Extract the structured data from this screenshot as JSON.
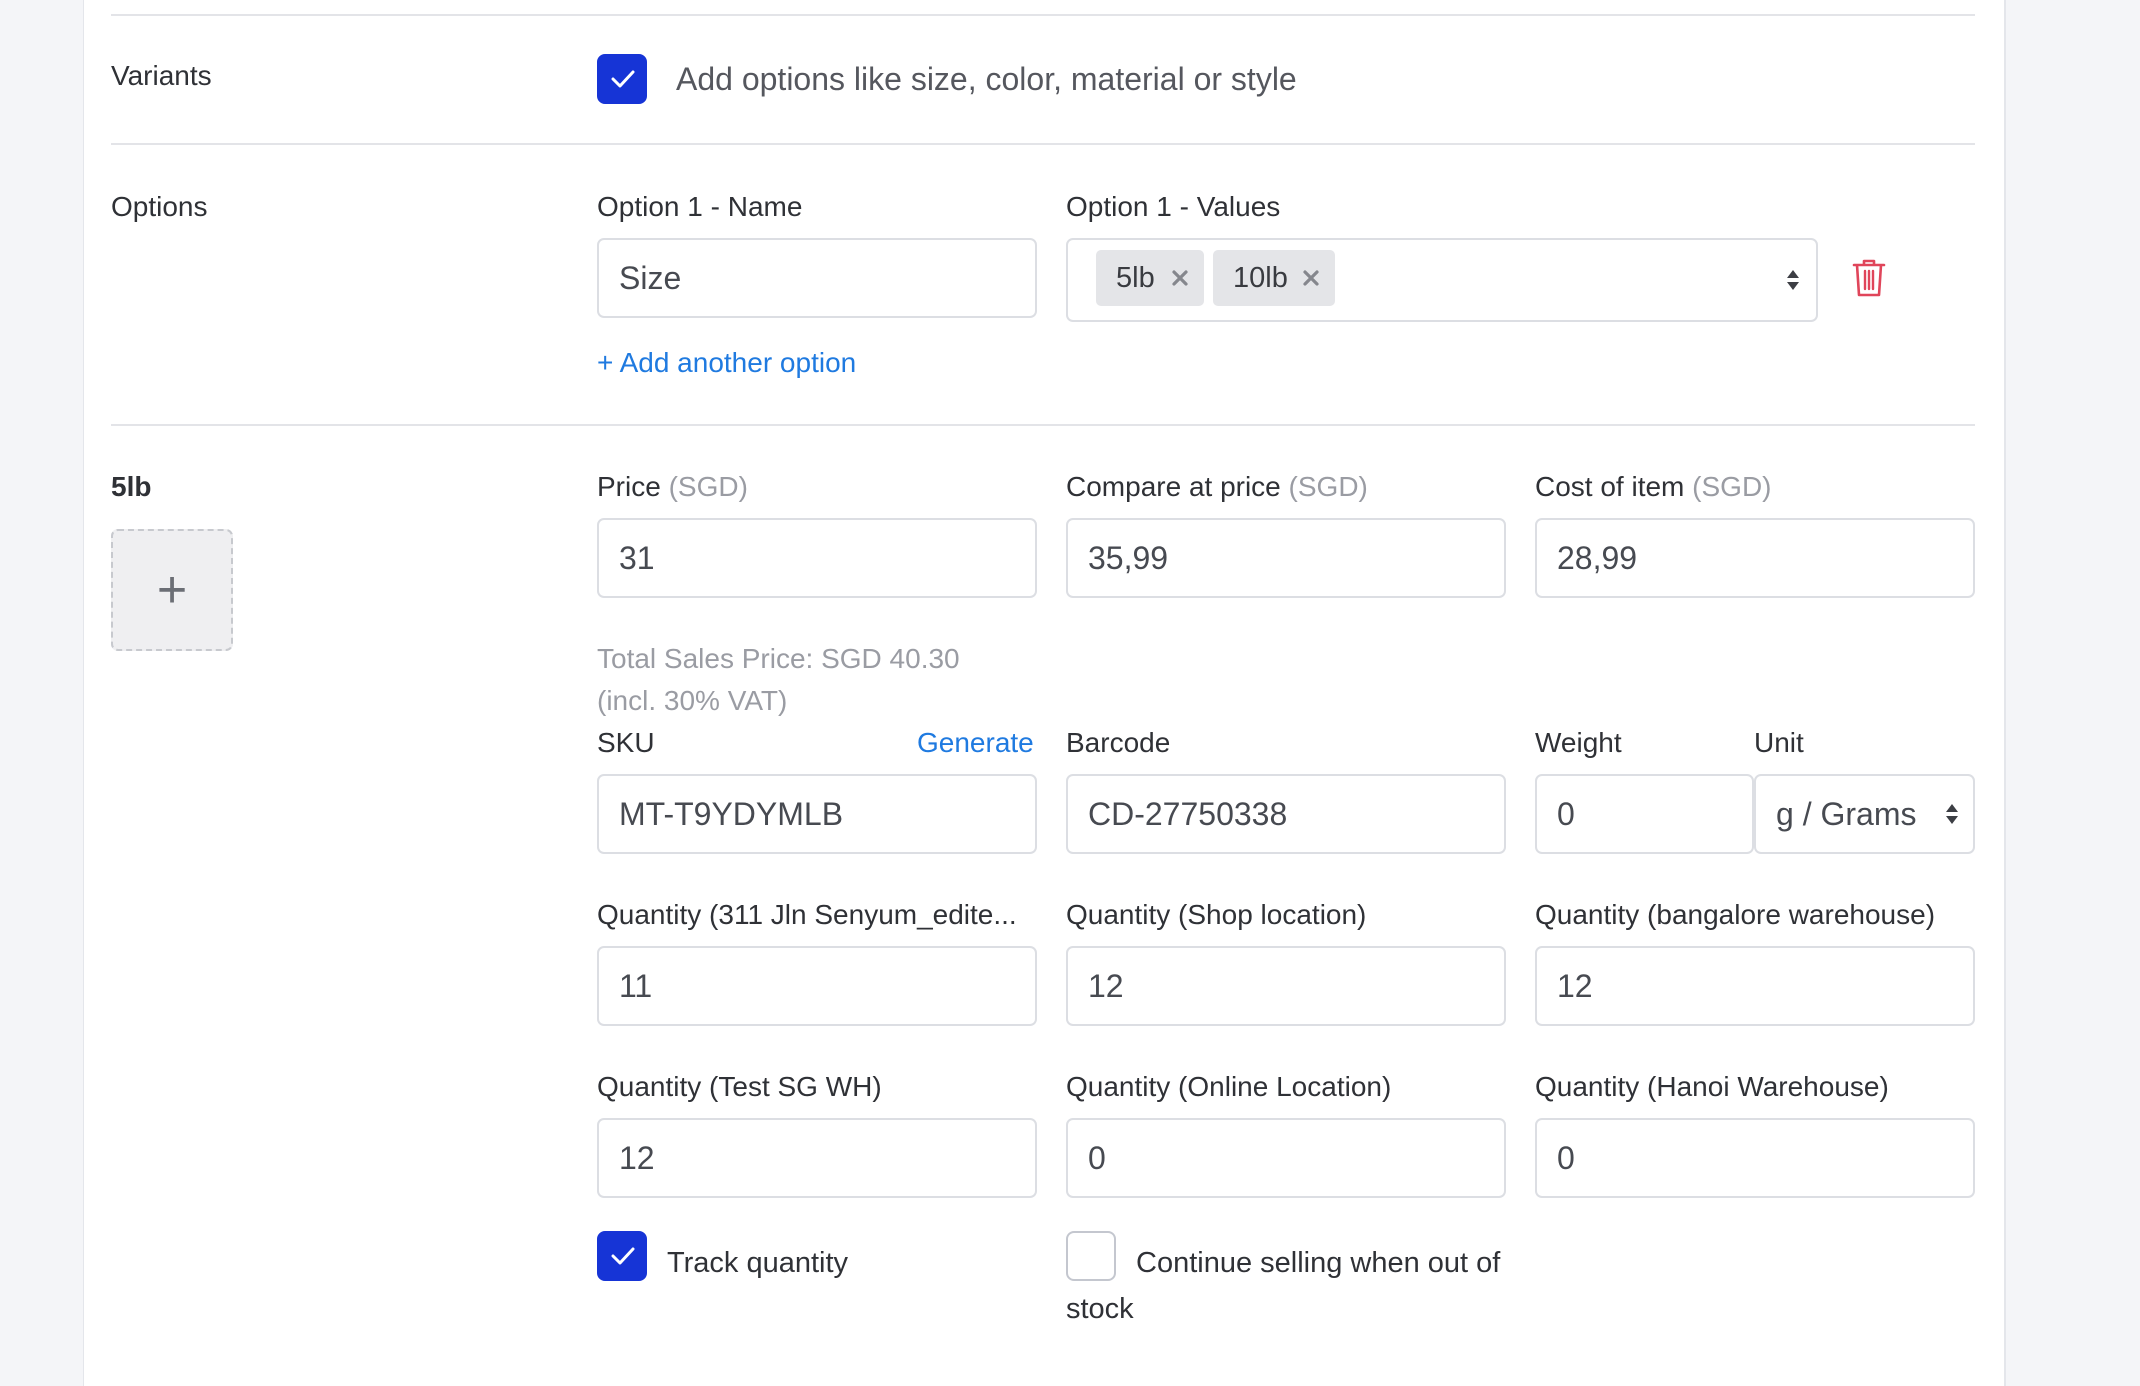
{
  "variants": {
    "label": "Variants",
    "checkbox_checked": true,
    "checkbox_label": "Add options like size, color, material or style"
  },
  "options": {
    "label": "Options",
    "name_label": "Option 1 - Name",
    "name_value": "Size",
    "values_label": "Option 1 - Values",
    "values": [
      "5lb",
      "10lb"
    ],
    "add_option": "+ Add another option"
  },
  "variant": {
    "title": "5lb",
    "add_image": "+",
    "price_label": "Price",
    "price_currency": "(SGD)",
    "price_value": "31",
    "compare_label": "Compare at price",
    "compare_currency": "(SGD)",
    "compare_value": "35,99",
    "cost_label": "Cost of item",
    "cost_currency": "(SGD)",
    "cost_value": "28,99",
    "total_sales_line1": "Total Sales Price: SGD 40.30",
    "total_sales_line2": "(incl. 30% VAT)",
    "sku_label": "SKU",
    "generate_link": "Generate",
    "sku_value": "MT-T9YDYMLB",
    "barcode_label": "Barcode",
    "barcode_value": "CD-27750338",
    "weight_label": "Weight",
    "weight_value": "0",
    "unit_label": "Unit",
    "unit_value": "g / Grams",
    "quantities": [
      {
        "label": "Quantity (311 Jln Senyum_edite...",
        "value": "11"
      },
      {
        "label": "Quantity (Shop location)",
        "value": "12"
      },
      {
        "label": "Quantity (bangalore warehouse)",
        "value": "12"
      },
      {
        "label": "Quantity (Test SG WH)",
        "value": "12"
      },
      {
        "label": "Quantity (Online Location)",
        "value": "0"
      },
      {
        "label": "Quantity (Hanoi Warehouse)",
        "value": "0"
      }
    ],
    "track_quantity_checked": true,
    "track_quantity_label": "Track quantity",
    "continue_selling_checked": false,
    "continue_selling_line1": "Continue selling when out of",
    "continue_selling_line2": "stock"
  },
  "colors": {
    "accent": "#1634d6",
    "link": "#1f7ae0",
    "delete": "#e0455a"
  }
}
